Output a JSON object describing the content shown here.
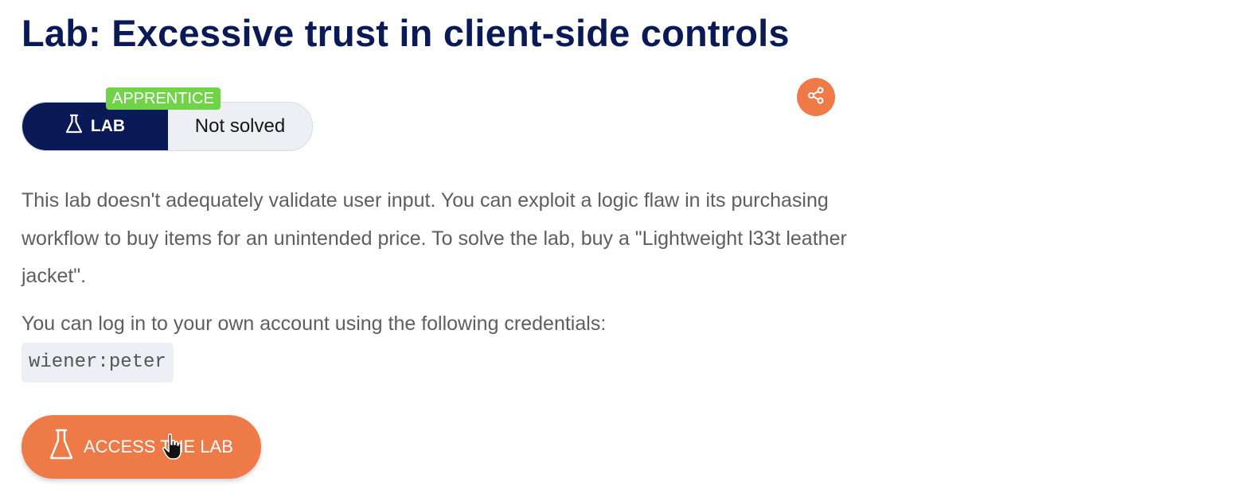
{
  "header": {
    "title": "Lab: Excessive trust in client-side controls"
  },
  "lab_badge": {
    "level": "APPRENTICE",
    "type_label": "LAB",
    "status": "Not solved",
    "icon": "flask-icon"
  },
  "share": {
    "icon": "share-icon"
  },
  "description": {
    "text": "This lab doesn't adequately validate user input. You can exploit a logic flaw in its purchasing workflow to buy items for an unintended price. To solve the lab, buy a \"Lightweight l33t leather jacket\"."
  },
  "credentials": {
    "intro": "You can log in to your own account using the following credentials:",
    "value": "wiener:peter"
  },
  "access_button": {
    "label": "ACCESS THE LAB",
    "icon": "flask-icon"
  },
  "colors": {
    "navy": "#0a1a57",
    "accent_orange": "#ee7a48",
    "level_green": "#70d34a",
    "pill_gray": "#eceff3"
  }
}
